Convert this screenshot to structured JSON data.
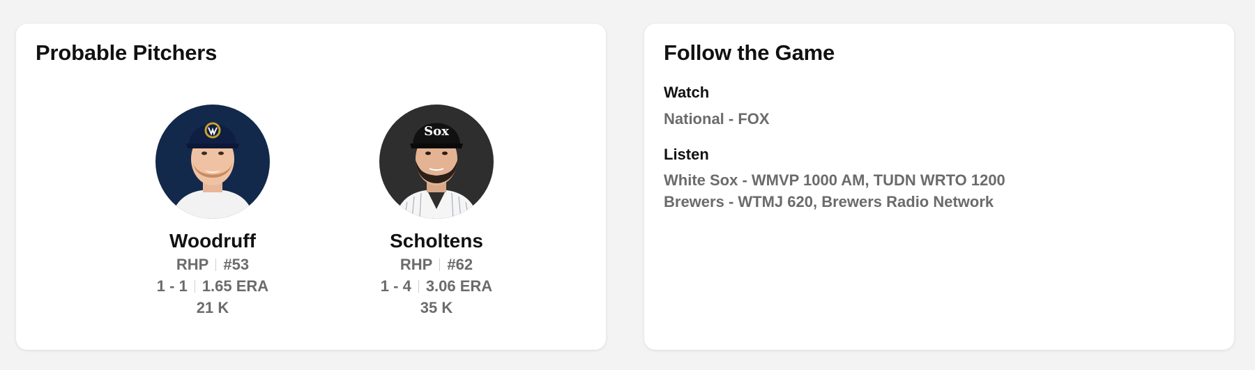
{
  "probable_pitchers": {
    "title": "Probable Pitchers",
    "pitchers": [
      {
        "name": "Woodruff",
        "throws": "RHP",
        "number": "#53",
        "record": "1 - 1",
        "era": "1.65 ERA",
        "strikeouts": "21 K",
        "avatar_bg": "#13294b",
        "cap_color": "#0f1f44",
        "logo_color": "#c9a227"
      },
      {
        "name": "Scholtens",
        "throws": "RHP",
        "number": "#62",
        "record": "1 - 4",
        "era": "3.06 ERA",
        "strikeouts": "35 K",
        "avatar_bg": "#2e2e2e",
        "cap_color": "#111111",
        "logo_color": "#ffffff"
      }
    ]
  },
  "follow_the_game": {
    "title": "Follow the Game",
    "watch": {
      "label": "Watch",
      "lines": [
        "National - FOX"
      ]
    },
    "listen": {
      "label": "Listen",
      "lines": [
        "White Sox - WMVP 1000 AM, TUDN WRTO 1200",
        "Brewers - WTMJ 620, Brewers Radio Network"
      ]
    }
  }
}
